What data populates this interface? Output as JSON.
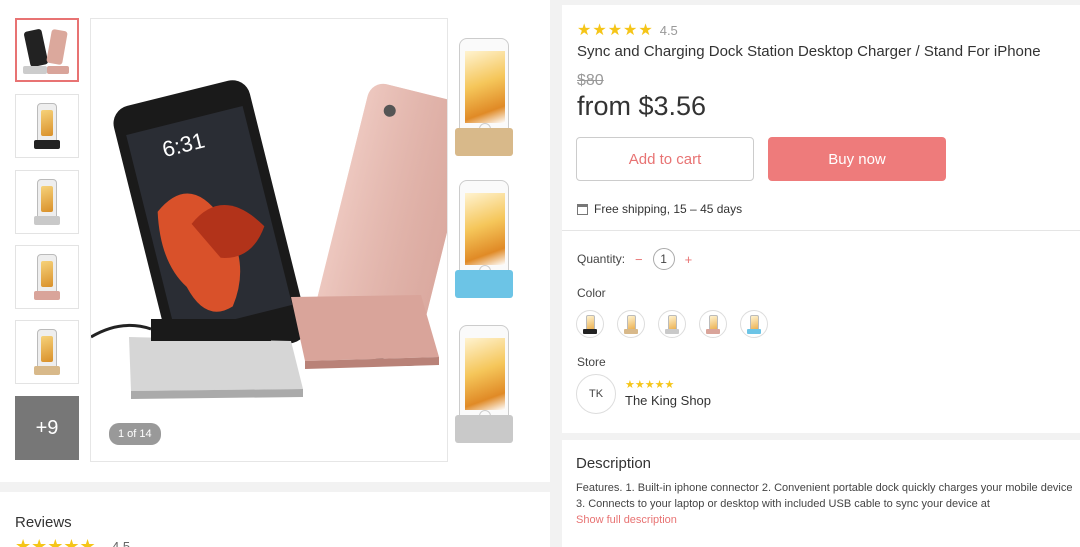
{
  "product": {
    "rating_stars": "★★★★★",
    "rating": "4.5",
    "title": "Sync and Charging Dock Station Desktop Charger / Stand For iPhone",
    "old_price": "$80",
    "price": "from $3.56"
  },
  "gallery": {
    "counter": "1 of 14",
    "more_label": "+9",
    "main_screen_time": "6:31"
  },
  "actions": {
    "add_to_cart": "Add to cart",
    "buy_now": "Buy now"
  },
  "shipping": {
    "text": "Free shipping, 15 – 45 days",
    "icon": "calendar-icon"
  },
  "quantity": {
    "label": "Quantity:",
    "minus": "−",
    "value": "1",
    "plus": "+"
  },
  "color": {
    "label": "Color",
    "options": [
      "black",
      "gold",
      "silver",
      "rose gold",
      "blue"
    ]
  },
  "store": {
    "label": "Store",
    "avatar_initials": "TK",
    "stars": "★★★★★",
    "name": "The King Shop"
  },
  "description": {
    "title": "Description",
    "text": "Features. 1. Built-in iphone connector 2. Convenient portable dock quickly charges your mobile device 3. Connects to your laptop or desktop with included USB cable to sync your device at",
    "link": "Show full description"
  },
  "reviews": {
    "title": "Reviews",
    "stars": "★★★★★",
    "rating": "4.5"
  },
  "colors": {
    "accent": "#ee7b7b",
    "star": "#f5c518",
    "rose_gold": "#d9a49a",
    "gold": "#d8b98a",
    "silver": "#c9c9c9",
    "blue": "#6cc4e6",
    "black": "#222222"
  }
}
